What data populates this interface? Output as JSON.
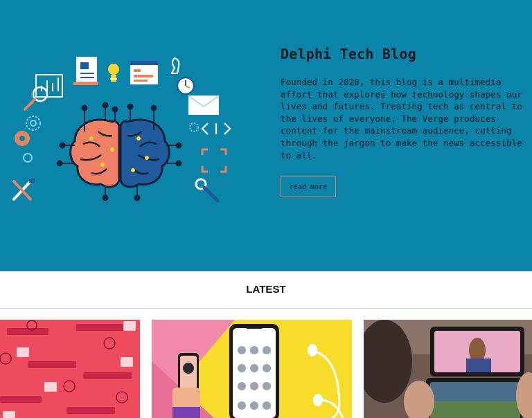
{
  "hero": {
    "title": "Delphi Tech Blog",
    "description": "Founded in 2020, this blog is a multimedia effort that explores how technology shapes our lives and futures. Treating tech as central to the lives of everyone, The Verge produces content for the mainstream audience, cutting through the jargon to make the news accessible to all.",
    "read_more_label": "read more",
    "background_color": "#0a84a8",
    "accent_color": "#e8835f"
  },
  "section": {
    "heading": "LATEST"
  },
  "cards": [
    {
      "image": "red-computer-users-illustration"
    },
    {
      "image": "phone-contacts-earbuds-illustration"
    },
    {
      "image": "dual-screen-phone-photo"
    }
  ]
}
